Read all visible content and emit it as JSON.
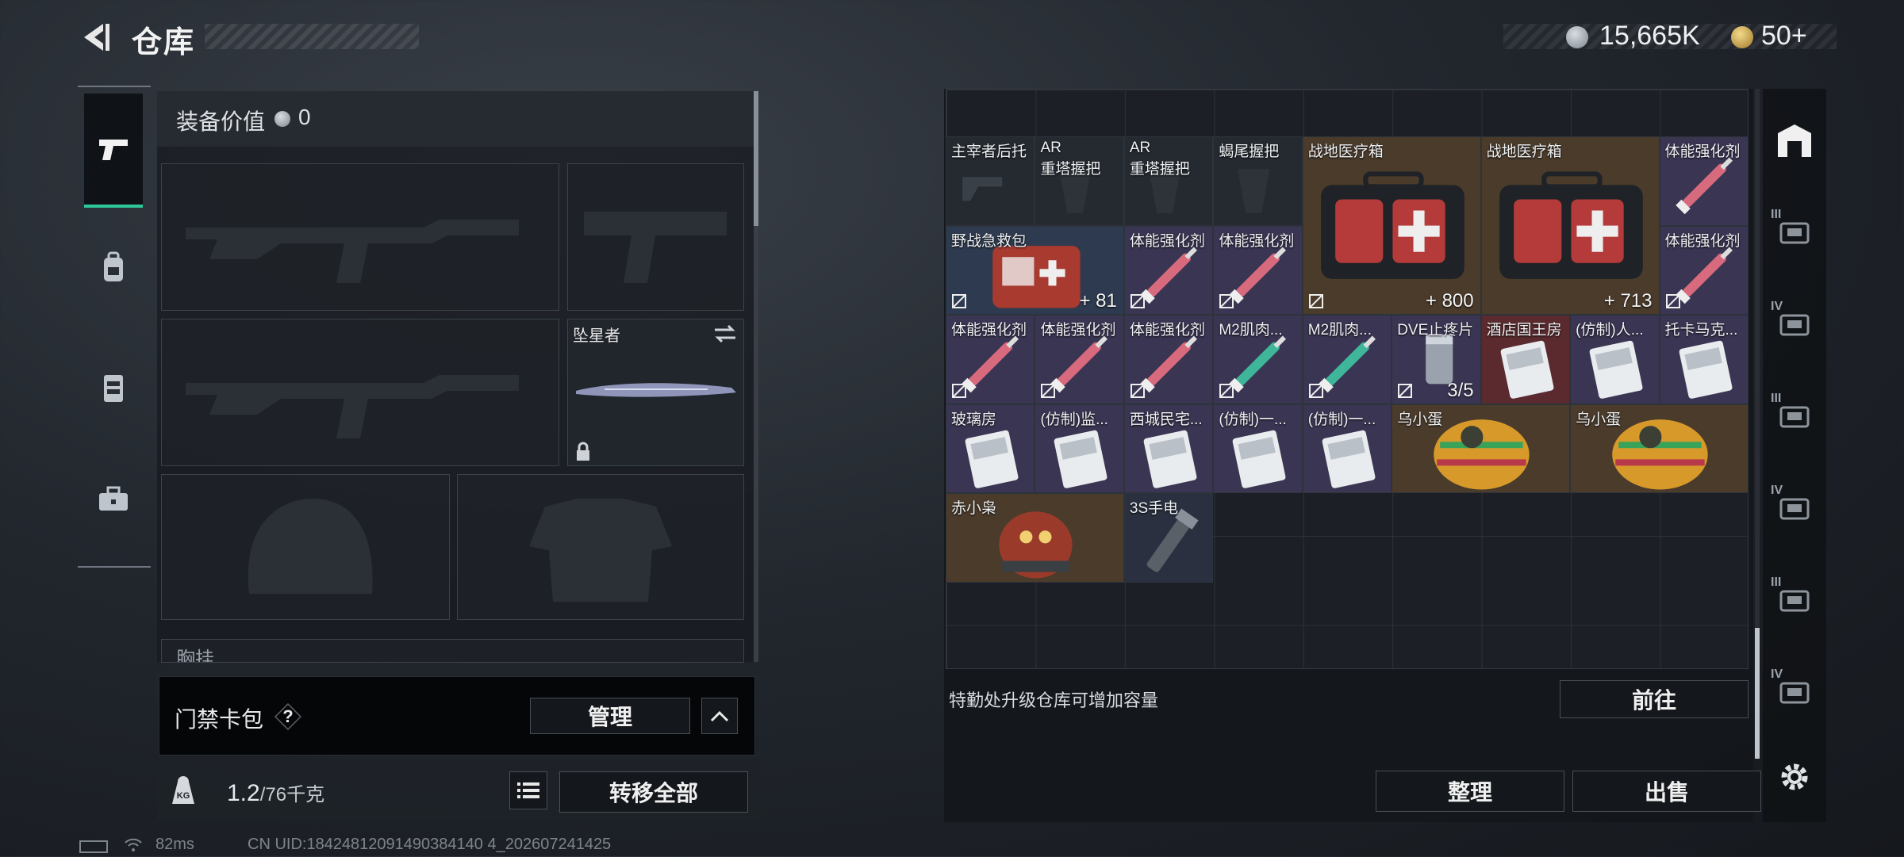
{
  "header": {
    "title": "仓库"
  },
  "currency": {
    "coins": "15,665K",
    "tickets": "50+"
  },
  "nav": {
    "items": [
      "weapons",
      "backpack",
      "vest",
      "briefcase"
    ]
  },
  "loadout": {
    "equip_value_label": "装备价值",
    "equip_value": "0",
    "melee_name": "坠星者",
    "chest_label": "胸挂"
  },
  "keycard": {
    "label": "门禁卡包",
    "help": "?",
    "manage": "管理"
  },
  "weight": {
    "current": "1.2",
    "max": "/76千克",
    "transfer_all": "转移全部",
    "kg_icon": "KG"
  },
  "inventory": {
    "items": [
      {
        "name": "主宰者后托",
        "count": ""
      },
      {
        "name": "AR\n重塔握把",
        "count": ""
      },
      {
        "name": "AR\n重塔握把",
        "count": ""
      },
      {
        "name": "蝎尾握把",
        "count": ""
      },
      {
        "name": "战地医疗箱",
        "count": "800"
      },
      {
        "name": "战地医疗箱",
        "count": "713"
      },
      {
        "name": "体能强化剂",
        "count": ""
      },
      {
        "name": "野战急救包",
        "count": "81"
      },
      {
        "name": "体能强化剂",
        "count": ""
      },
      {
        "name": "体能强化剂",
        "count": ""
      },
      {
        "name": "体能强化剂",
        "count": ""
      },
      {
        "name": "体能强化剂",
        "count": ""
      },
      {
        "name": "体能强化剂",
        "count": ""
      },
      {
        "name": "体能强化剂",
        "count": ""
      },
      {
        "name": "M2肌肉...",
        "count": ""
      },
      {
        "name": "M2肌肉...",
        "count": ""
      },
      {
        "name": "DVE止疼片",
        "count": "3/5"
      },
      {
        "name": "酒店国王房",
        "count": ""
      },
      {
        "name": "(仿制)人...",
        "count": ""
      },
      {
        "name": "托卡马克...",
        "count": ""
      },
      {
        "name": "玻璃房",
        "count": ""
      },
      {
        "name": "(仿制)监...",
        "count": ""
      },
      {
        "name": "西城民宅...",
        "count": ""
      },
      {
        "name": "(仿制)一...",
        "count": ""
      },
      {
        "name": "(仿制)一...",
        "count": ""
      },
      {
        "name": "乌小蛋",
        "count": ""
      },
      {
        "name": "乌小蛋",
        "count": ""
      },
      {
        "name": "赤小枭",
        "count": ""
      },
      {
        "name": "3S手电",
        "count": ""
      }
    ],
    "upgrade_tip": "特勤处升级仓库可增加容量",
    "goto": "前往",
    "sort": "整理",
    "sell": "出售"
  },
  "side_tiers": [
    "III",
    "IV",
    "III",
    "IV",
    "III",
    "IV"
  ],
  "status": {
    "ping": "82ms",
    "uid": "CN UID:18424812091490384140 4_202607241425"
  },
  "colors": {
    "accent": "#2fc79a",
    "rare_red": "#6b2a2a",
    "epic_purple": "#3a3552",
    "gold": "#5a4a2e"
  }
}
